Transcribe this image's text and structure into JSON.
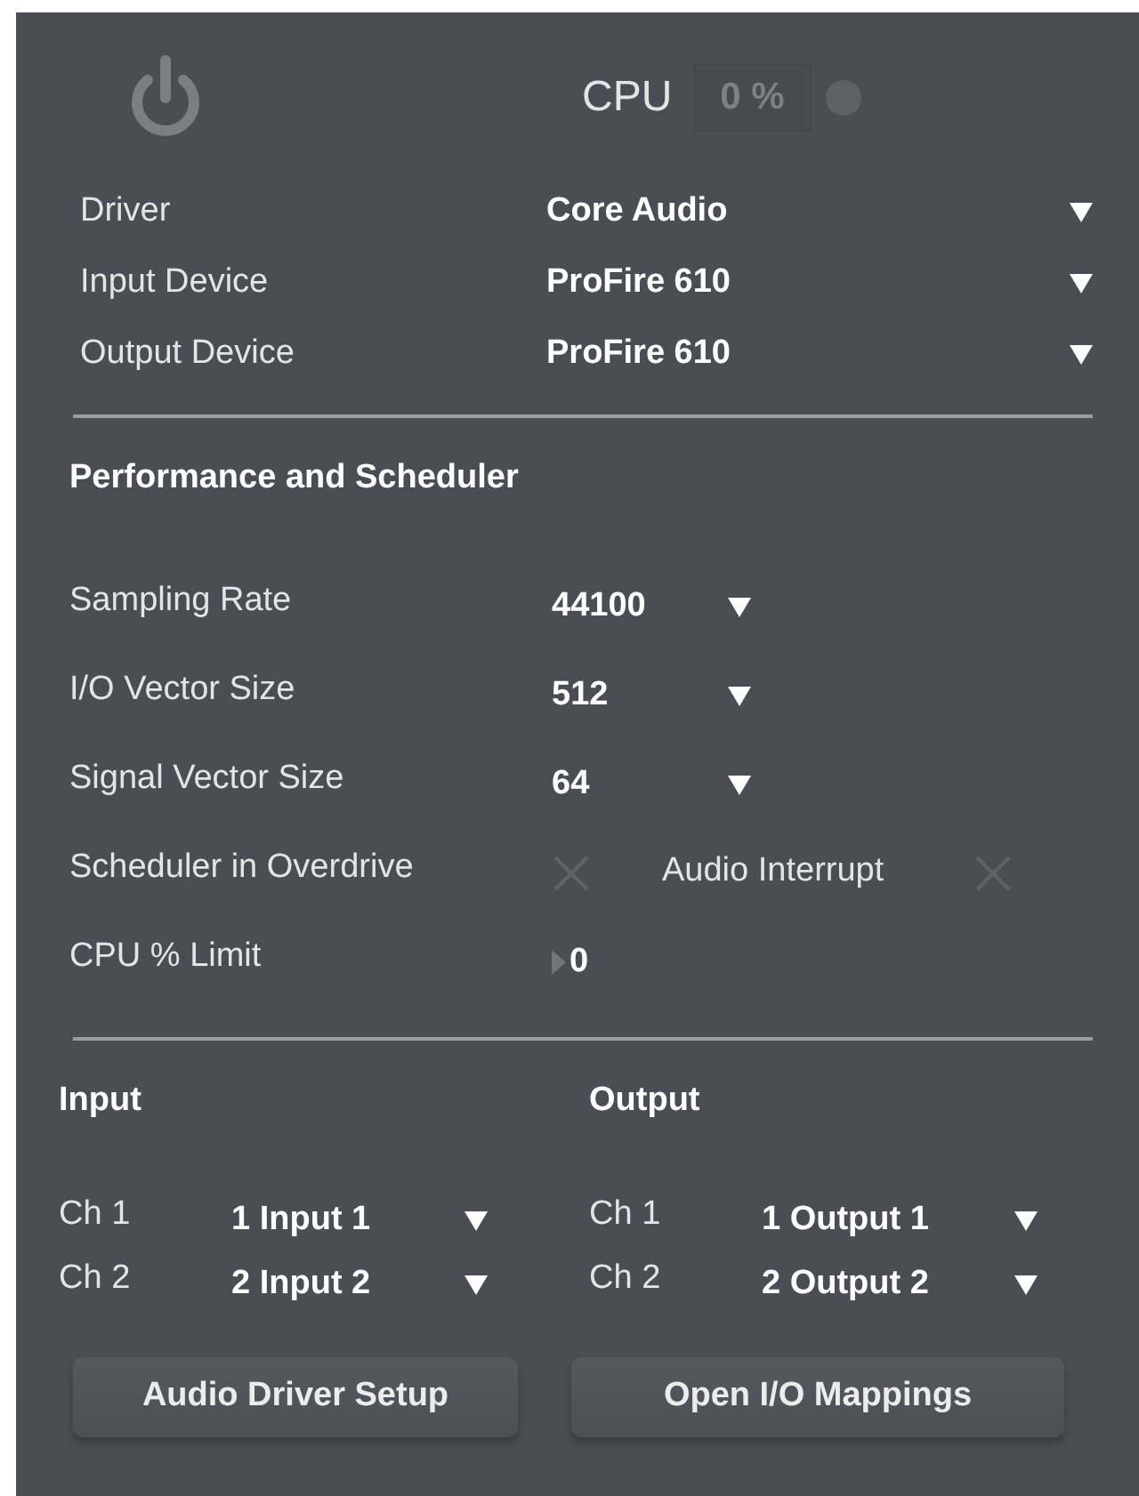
{
  "header": {
    "cpu_label": "CPU",
    "cpu_value": "0 %",
    "power_on": false,
    "cpu_active": false
  },
  "devices": [
    {
      "label": "Driver",
      "value": "Core Audio"
    },
    {
      "label": "Input Device",
      "value": "ProFire 610"
    },
    {
      "label": "Output Device",
      "value": "ProFire 610"
    }
  ],
  "performance": {
    "title": "Performance and Scheduler",
    "rows": [
      {
        "kind": "select",
        "label": "Sampling Rate",
        "value": "44100"
      },
      {
        "kind": "select",
        "label": "I/O Vector Size",
        "value": "512"
      },
      {
        "kind": "select",
        "label": "Signal Vector Size",
        "value": "64"
      },
      {
        "kind": "toggles",
        "label": "Scheduler in Overdrive",
        "checked": false,
        "label_2": "Audio Interrupt",
        "checked_2": false
      },
      {
        "kind": "number",
        "label": "CPU % Limit",
        "value": "0"
      }
    ]
  },
  "io": [
    {
      "title": "Input",
      "channels": [
        {
          "label": "Ch 1",
          "value": "1 Input 1"
        },
        {
          "label": "Ch 2",
          "value": "2 Input 2"
        }
      ]
    },
    {
      "title": "Output",
      "channels": [
        {
          "label": "Ch 1",
          "value": "1 Output 1"
        },
        {
          "label": "Ch 2",
          "value": "2 Output 2"
        }
      ]
    }
  ],
  "buttons": [
    "Audio Driver Setup",
    "Open I/O Mappings"
  ]
}
